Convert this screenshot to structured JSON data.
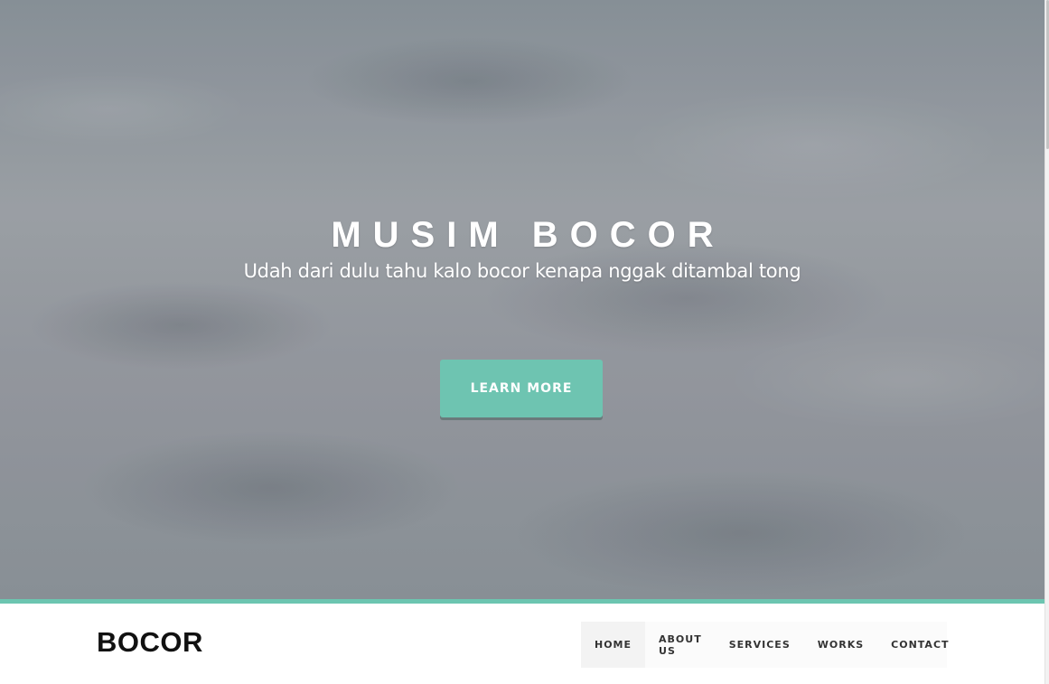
{
  "hero": {
    "title": "MUSIM BOCOR",
    "subtitle": "Udah dari dulu tahu kalo bocor kenapa nggak ditambal tong",
    "cta_label": "LEARN MORE"
  },
  "header": {
    "logo": "BOCOR",
    "nav": [
      {
        "label": "HOME"
      },
      {
        "label": "ABOUT US"
      },
      {
        "label": "SERVICES"
      },
      {
        "label": "WORKS"
      },
      {
        "label": "CONTACT"
      }
    ]
  },
  "colors": {
    "accent": "#6ec4b1",
    "text_dark": "#111111"
  }
}
